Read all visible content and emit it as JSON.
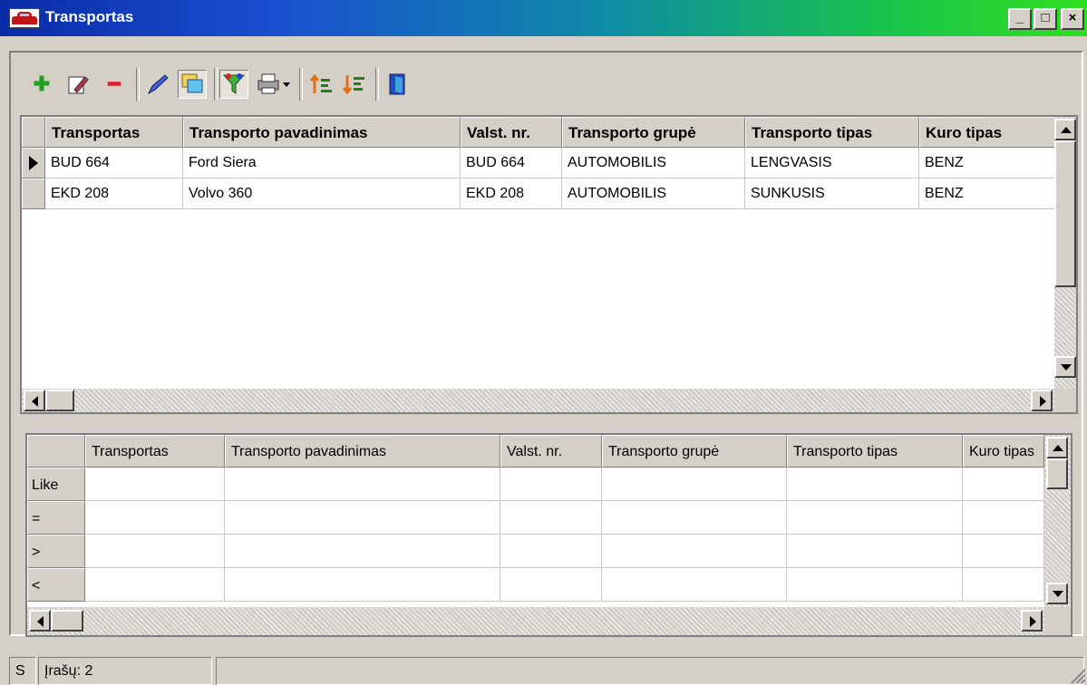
{
  "window": {
    "title": "Transportas"
  },
  "title_buttons": {
    "minimize": "_",
    "maximize": "□",
    "close": "×"
  },
  "toolbar": {
    "icons": [
      "add-icon",
      "edit-icon",
      "delete-icon",
      "pen-icon",
      "copy-icon",
      "filter-icon",
      "print-icon",
      "sort-asc-icon",
      "sort-desc-icon",
      "exit-icon"
    ]
  },
  "grid": {
    "columns": [
      "Transportas",
      "Transporto pavadinimas",
      "Valst. nr.",
      "Transporto grupė",
      "Transporto tipas",
      "Kuro tipas"
    ],
    "rows": [
      [
        "BUD 664",
        "Ford Siera",
        "BUD 664",
        "AUTOMOBILIS",
        "LENGVASIS",
        "BENZ"
      ],
      [
        "EKD 208",
        "Volvo  360",
        "EKD 208",
        "AUTOMOBILIS",
        "SUNKUSIS",
        "BENZ"
      ]
    ]
  },
  "filter": {
    "columns": [
      "Transportas",
      "Transporto pavadinimas",
      "Valst. nr.",
      "Transporto grupė",
      "Transporto tipas",
      "Kuro tipas"
    ],
    "operators": [
      "Like",
      "=",
      ">",
      "<"
    ]
  },
  "statusbar": {
    "mode": "S",
    "records": "Įrašų: 2"
  },
  "colors": {
    "title_start": "#0a2ca8",
    "title_end": "#30e020",
    "face": "#d4d0c8"
  }
}
